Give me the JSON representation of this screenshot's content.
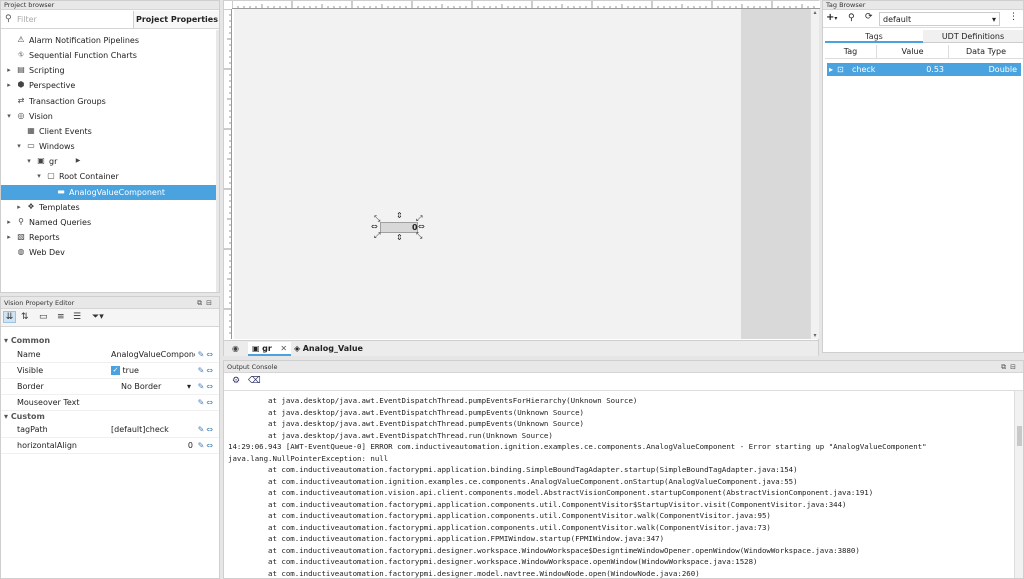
{
  "project_browser": {
    "title": "Project browser",
    "filter_placeholder": "Filter",
    "properties_tab": "Project Properties",
    "tree": [
      {
        "label": "Alarm Notification Pipelines",
        "icon": "alarm-pipeline-icon",
        "depth": 0,
        "twisty": ""
      },
      {
        "label": "Sequential Function Charts",
        "icon": "sfc-icon",
        "depth": 0,
        "twisty": ""
      },
      {
        "label": "Scripting",
        "icon": "scripting-icon",
        "depth": 0,
        "twisty": "▸"
      },
      {
        "label": "Perspective",
        "icon": "perspective-icon",
        "depth": 0,
        "twisty": "▸"
      },
      {
        "label": "Transaction Groups",
        "icon": "transaction-groups-icon",
        "depth": 0,
        "twisty": ""
      },
      {
        "label": "Vision",
        "icon": "vision-icon",
        "depth": 0,
        "twisty": "▾"
      },
      {
        "label": "Client Events",
        "icon": "client-events-icon",
        "depth": 1,
        "twisty": ""
      },
      {
        "label": "Windows",
        "icon": "windows-folder-icon",
        "depth": 1,
        "twisty": "▾"
      },
      {
        "label": "gr",
        "icon": "window-icon",
        "depth": 2,
        "twisty": "▾"
      },
      {
        "label": "Root Container",
        "icon": "root-container-icon",
        "depth": 3,
        "twisty": "▾"
      },
      {
        "label": "AnalogValueComponent",
        "icon": "component-icon",
        "depth": 4,
        "twisty": "",
        "selected": true
      },
      {
        "label": "Templates",
        "icon": "templates-icon",
        "depth": 1,
        "twisty": "▸"
      },
      {
        "label": "Named Queries",
        "icon": "named-queries-icon",
        "depth": 0,
        "twisty": "▸"
      },
      {
        "label": "Reports",
        "icon": "reports-icon",
        "depth": 0,
        "twisty": "▸"
      },
      {
        "label": "Web Dev",
        "icon": "web-dev-icon",
        "depth": 0,
        "twisty": ""
      }
    ]
  },
  "property_editor": {
    "title": "Vision Property Editor",
    "sections": {
      "common": "Common",
      "custom": "Custom"
    },
    "common_props": [
      {
        "name": "Name",
        "value": "AnalogValueComponent"
      },
      {
        "name": "Visible",
        "value": "true"
      },
      {
        "name": "Border",
        "value": "No Border"
      },
      {
        "name": "Mouseover Text",
        "value": ""
      }
    ],
    "custom_props": [
      {
        "name": "tagPath",
        "value": "[default]check"
      },
      {
        "name": "horizontalAlign",
        "value": "0"
      }
    ]
  },
  "designer": {
    "component_value": "0",
    "tabs": [
      {
        "label": "gr"
      },
      {
        "label": "Analog_Value"
      }
    ]
  },
  "tag_browser": {
    "title": "Tag Browser",
    "provider": "default",
    "tabs": [
      "Tags",
      "UDT Definitions"
    ],
    "columns": [
      "Tag",
      "Value",
      "Data Type"
    ],
    "rows": [
      {
        "tag": "check",
        "value": "0.53",
        "data_type": "Double"
      }
    ]
  },
  "console": {
    "title": "Output Console",
    "lines": [
      "         at java.desktop/java.awt.EventDispatchThread.pumpEventsForHierarchy(Unknown Source)",
      "         at java.desktop/java.awt.EventDispatchThread.pumpEvents(Unknown Source)",
      "         at java.desktop/java.awt.EventDispatchThread.pumpEvents(Unknown Source)",
      "         at java.desktop/java.awt.EventDispatchThread.run(Unknown Source)",
      "14:29:06.943 [AWT-EventQueue-0] ERROR com.inductiveautomation.ignition.examples.ce.components.AnalogValueComponent - Error starting up \"AnalogValueComponent\"",
      "java.lang.NullPointerException: null",
      "         at com.inductiveautomation.factorypmi.application.binding.SimpleBoundTagAdapter.startup(SimpleBoundTagAdapter.java:154)",
      "         at com.inductiveautomation.ignition.examples.ce.components.AnalogValueComponent.onStartup(AnalogValueComponent.java:55)",
      "         at com.inductiveautomation.vision.api.client.components.model.AbstractVisionComponent.startupComponent(AbstractVisionComponent.java:191)",
      "         at com.inductiveautomation.factorypmi.application.components.util.ComponentVisitor$StartupVisitor.visit(ComponentVisitor.java:344)",
      "         at com.inductiveautomation.factorypmi.application.components.util.ComponentVisitor.walk(ComponentVisitor.java:95)",
      "         at com.inductiveautomation.factorypmi.application.components.util.ComponentVisitor.walk(ComponentVisitor.java:73)",
      "         at com.inductiveautomation.factorypmi.application.FPMIWindow.startup(FPMIWindow.java:347)",
      "         at com.inductiveautomation.factorypmi.designer.workspace.WindowWorkspace$DesigntimeWindowOpener.openWindow(WindowWorkspace.java:3880)",
      "         at com.inductiveautomation.factorypmi.designer.workspace.WindowWorkspace.openWindow(WindowWorkspace.java:1528)",
      "         at com.inductiveautomation.factorypmi.designer.model.navtree.WindowNode.open(WindowNode.java:260)"
    ]
  }
}
